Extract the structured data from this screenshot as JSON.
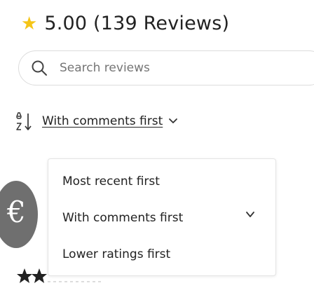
{
  "rating": {
    "star_icon": "star-icon",
    "star_color": "#f5c518",
    "text": "5.00 (139 Reviews)"
  },
  "search": {
    "placeholder": "Search reviews",
    "value": "",
    "icon": "search-icon"
  },
  "sort": {
    "label": "With comments first",
    "icon": "sort-icon",
    "chevron": "chevron-down-icon"
  },
  "dropdown": {
    "options": [
      {
        "label": "Most recent first",
        "selected": false
      },
      {
        "label": "With comments first",
        "selected": true
      },
      {
        "label": "Lower ratings first",
        "selected": false
      }
    ],
    "selected_icon": "checkmark-icon"
  },
  "review": {
    "avatar_icon": "avatar",
    "avatar_glyph": "€",
    "stars_icon": "star-icon",
    "stars_color": "#222222"
  }
}
